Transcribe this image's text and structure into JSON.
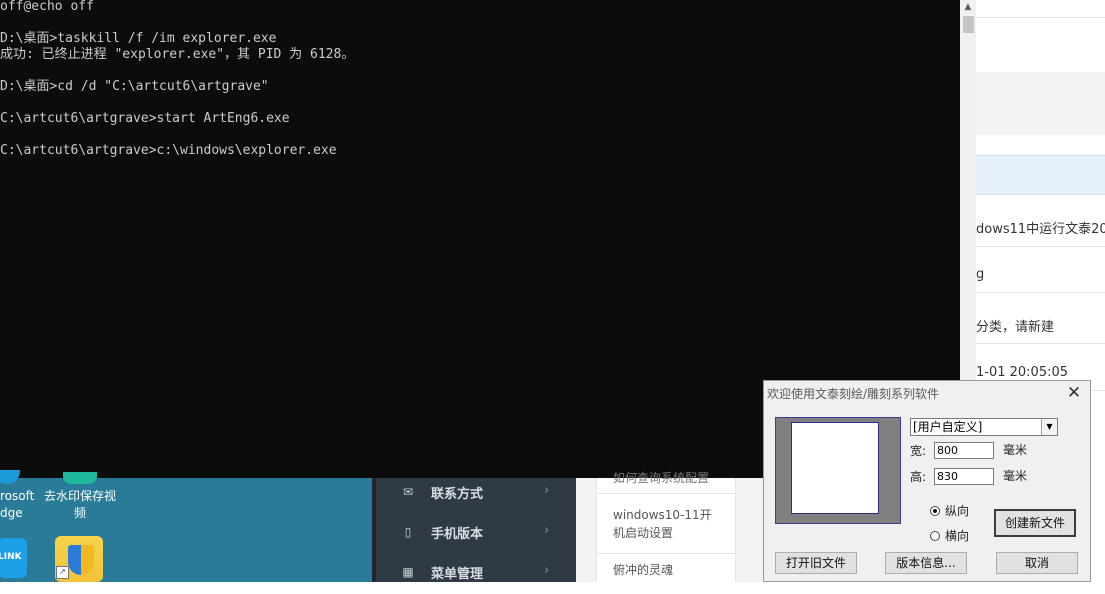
{
  "console": {
    "lines": [
      "off@echo off",
      "",
      "D:\\桌面>taskkill /f /im explorer.exe",
      "成功: 已终止进程 \"explorer.exe\"，其 PID 为 6128。",
      "",
      "D:\\桌面>cd /d \"C:\\artcut6\\artgrave\"",
      "",
      "C:\\artcut6\\artgrave>start ArtEng6.exe",
      "",
      "C:\\artcut6\\artgrave>c:\\windows\\explorer.exe"
    ]
  },
  "browser_right": {
    "title_fragment": "dows11中运行文泰20",
    "line2": "g",
    "line3": "分类，请新建",
    "timestamp": "1-01 20:05:05"
  },
  "desktop": {
    "edge_label_1": "rosoft",
    "edge_label_2": "dge",
    "watermark_label_1": "去水印保存视",
    "watermark_label_2": "频",
    "tplink_label": "LINK"
  },
  "menu": {
    "items": [
      {
        "icon": "✉",
        "label": "联系方式",
        "arrow": "›"
      },
      {
        "icon": "▯",
        "label": "手机版本",
        "arrow": "›"
      },
      {
        "icon": "▦",
        "label": "菜单管理",
        "arrow": "›"
      }
    ]
  },
  "articles": {
    "partial_top": "如何查询系统配置",
    "item1_line1": "windows10-11开",
    "item1_line2": "机启动设置",
    "item2": "俯冲的灵魂"
  },
  "dialog": {
    "title": "欢迎使用文泰刻绘/雕刻系列软件",
    "close": "✕",
    "size_preset": "[用户自定义]",
    "width_label": "宽:",
    "width_value": "800",
    "width_unit": "毫米",
    "height_label": "高:",
    "height_value": "830",
    "height_unit": "毫米",
    "orientation_portrait": "纵向",
    "orientation_landscape": "横向",
    "create_button": "创建新文件",
    "open_button": "打开旧文件",
    "version_button": "版本信息...",
    "cancel_button": "取消"
  }
}
